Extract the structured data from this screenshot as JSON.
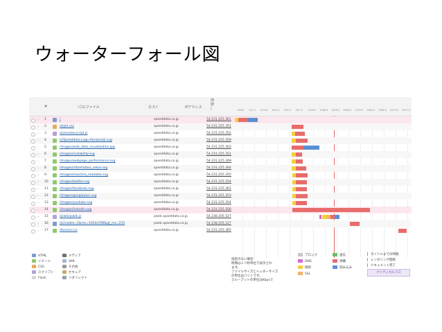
{
  "slide": {
    "title": "ウォーターフォール図"
  },
  "header": {
    "num": "#",
    "path": "パス/ファイル",
    "host": "ホスト",
    "ip": "IPアドレス",
    "sort": "持\n続\n(",
    "ticks": [
      "158.6",
      "317.1",
      "475.6",
      "634.0",
      "792.5",
      "951.0",
      "1109.5",
      "1268.0",
      "1426.5",
      "1585.0",
      "1743.5",
      "1902.0",
      "2060.5",
      "2219.0",
      "2377.5"
    ]
  },
  "rows": [
    {
      "n": "1",
      "path": "/",
      "host": "speeddata.co.jp",
      "ip": "54.231.225.361",
      "icon": "#7b9bd1"
    },
    {
      "n": "2",
      "path": "/style.css",
      "host": "speeddata.co.jp",
      "ip": "54.231.225.351",
      "icon": "#e6a85c"
    },
    {
      "n": "3",
      "path": "/overview.script.js",
      "host": "speeddata.co.jp",
      "ip": "54.231.225.352",
      "icon": "#b0a2d9"
    },
    {
      "n": "4",
      "path": "/s/Speeddata.Logo-Horizontal.svg",
      "host": "speeddata.co.jp",
      "ip": "54.231.225.359",
      "icon": "#8fc96b"
    },
    {
      "n": "5",
      "path": "/images/web_data_visualization.jpg",
      "host": "speeddata.co.jp",
      "ip": "54.231.225.363",
      "icon": "#8fc96b"
    },
    {
      "n": "6",
      "path": "/images/scalability.svg",
      "host": "speeddata.co.jp",
      "ip": "54.231.225.351",
      "icon": "#8fc96b"
    },
    {
      "n": "7",
      "path": "/images/webpage_performance.svg",
      "host": "speeddata.co.jp",
      "ip": "54.231.225.369",
      "icon": "#8fc96b"
    },
    {
      "n": "8",
      "path": "/images/information_value.svg",
      "host": "speeddata.co.jp",
      "ip": "54.231.225.364",
      "icon": "#8fc96b"
    },
    {
      "n": "9",
      "path": "/images/machine_readable.svg",
      "host": "speeddata.co.jp",
      "ip": "54.231.225.355",
      "icon": "#8fc96b"
    },
    {
      "n": "10",
      "path": "/images/twitter.svg",
      "host": "speeddata.co.jp",
      "ip": "54.231.225.354",
      "icon": "#8fc96b"
    },
    {
      "n": "11",
      "path": "/images/facebook.svg",
      "host": "speeddata.co.jp",
      "ip": "54.231.225.361",
      "icon": "#8fc96b"
    },
    {
      "n": "12",
      "path": "/images/googleplus.svg",
      "host": "speeddata.co.jp",
      "ip": "54.231.225.353",
      "icon": "#8fc96b"
    },
    {
      "n": "13",
      "path": "/images/youtube.svg",
      "host": "speeddata.co.jp",
      "ip": "54.231.225.354",
      "icon": "#8fc96b"
    },
    {
      "n": "14",
      "path": "/images/linkedin.svg",
      "host": "speeddata.co.jp",
      "ip": "54.231.225.356",
      "icon": "#8fc96b"
    },
    {
      "n": "15",
      "path": "/piwik/piwik.js",
      "host": "piwik.speeddata.co.jp",
      "ip": "54.238.205.527",
      "icon": "#b0a2d9"
    },
    {
      "n": "16",
      "path": "/js/cookie=1&res=1024x768&gt_ms=235",
      "host": "piwik.speeddata.co.jp",
      "ip": "54.238.205.527",
      "icon": "#7b9bd1"
    },
    {
      "n": "17",
      "path": "/favicon.ico",
      "host": "speeddata.co.jp",
      "ip": "54.231.225.365",
      "icon": "#8fc96b"
    }
  ],
  "colors": {
    "block": "#c8c8c8",
    "dns": "#d46bd6",
    "connect": "#f2d13d",
    "ssl": "#f2b36b",
    "send": "#6dbe6d",
    "wait": "#e86c6c",
    "receive": "#5b8fd4"
  },
  "legend_types": [
    {
      "label": "HTML",
      "color": "#7b9bd1"
    },
    {
      "label": "イメージ",
      "color": "#8fc96b"
    },
    {
      "label": "CSS",
      "color": "#e6a85c"
    },
    {
      "label": "スクリプト",
      "color": "#b0a2d9"
    },
    {
      "label": "Flash",
      "color": "#d9d9d9"
    },
    {
      "label": "メディア",
      "color": "#6f6f6f"
    },
    {
      "label": "XML",
      "color": "#9fb8d9"
    },
    {
      "label": "その他",
      "color": "#9a9a9a"
    },
    {
      "label": "セキュア",
      "color": "#c9a86a"
    },
    {
      "label": "リダイレクト",
      "color": "#9aa0a8"
    }
  ],
  "legend_note": [
    "指定のない場合:",
    "時間はミリ秒単位で表示され",
    "ます。",
    "ファイルサイズとヘッダーサイズ",
    "の単位はバイトです。",
    "スループットの単位はKbpsで",
    "す。"
  ],
  "legend_phases": [
    {
      "label": "ブロック",
      "key": "block"
    },
    {
      "label": "DNS",
      "key": "dns"
    },
    {
      "label": "接続",
      "key": "connect"
    },
    {
      "label": "SSL",
      "key": "ssl"
    },
    {
      "label": "送信",
      "key": "send"
    },
    {
      "label": "待機",
      "key": "wait"
    },
    {
      "label": "読み込み",
      "key": "receive"
    }
  ],
  "legend_marks": [
    "タイトルまでの時間",
    "レンダリング開始",
    "ドキュメント完了"
  ],
  "critical_path": "クリティカルパス",
  "bars": [
    [
      [
        "connect",
        0.1,
        1.2
      ],
      [
        "wait",
        1.2,
        4.0
      ],
      [
        "receive",
        4.0,
        6.8
      ]
    ],
    [
      [
        "wait",
        16.5,
        19.8
      ]
    ],
    [
      [
        "connect",
        16.4,
        17.5
      ],
      [
        "wait",
        17.5,
        20.2
      ]
    ],
    [
      [
        "connect",
        16.4,
        17.6
      ],
      [
        "wait",
        17.6,
        21.0
      ]
    ],
    [
      [
        "wait",
        16.5,
        19.9
      ],
      [
        "receive",
        19.9,
        24.5
      ]
    ],
    [
      [
        "connect",
        16.4,
        17.6
      ],
      [
        "wait",
        17.6,
        19.4
      ]
    ],
    [
      [
        "connect",
        16.4,
        17.6
      ],
      [
        "wait",
        17.6,
        19.6
      ]
    ],
    [
      [
        "connect",
        16.5,
        17.6
      ],
      [
        "wait",
        17.6,
        20.6
      ]
    ],
    [
      [
        "connect",
        16.6,
        17.7
      ],
      [
        "wait",
        17.7,
        21.0
      ]
    ],
    [
      [
        "connect",
        16.6,
        17.7
      ],
      [
        "wait",
        17.7,
        20.8
      ]
    ],
    [
      [
        "connect",
        16.6,
        17.7
      ],
      [
        "wait",
        17.7,
        20.8
      ]
    ],
    [
      [
        "connect",
        16.6,
        17.7
      ],
      [
        "wait",
        17.7,
        21.1
      ]
    ],
    [
      [
        "connect",
        16.6,
        17.7
      ],
      [
        "wait",
        17.7,
        20.8
      ]
    ],
    [
      [
        "wait",
        16.7,
        38.8
      ]
    ],
    [
      [
        "dns",
        24.5,
        25.1
      ],
      [
        "connect",
        25.1,
        26.5
      ],
      [
        "ssl",
        26.5,
        27.6
      ],
      [
        "wait",
        27.6,
        28.7
      ],
      [
        "receive",
        28.7,
        30.2
      ]
    ],
    [
      [
        "wait",
        33.2,
        36.0
      ]
    ],
    [
      [
        "wait",
        47.0,
        49.5
      ]
    ]
  ]
}
